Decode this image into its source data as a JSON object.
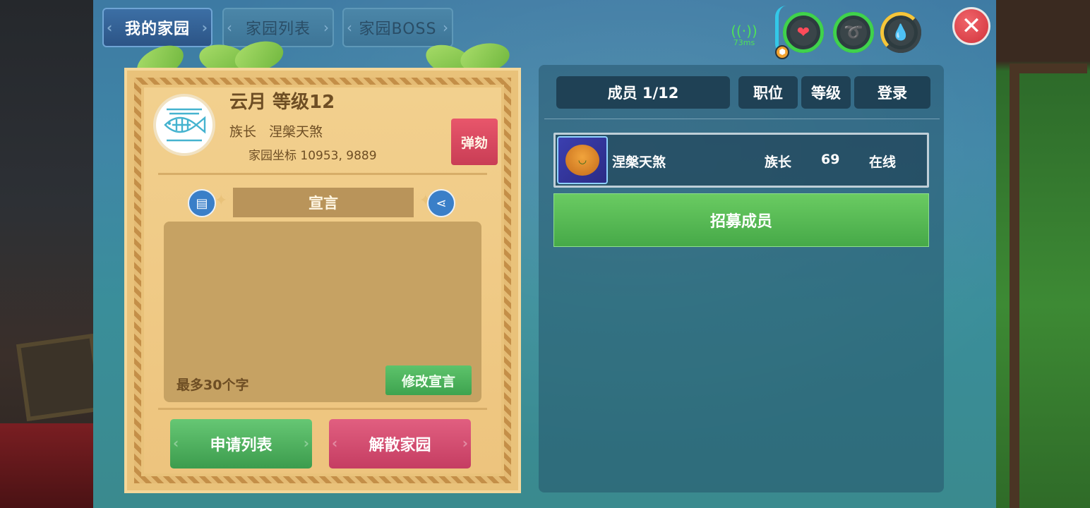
{
  "tabs": [
    {
      "label": "我的家园",
      "active": true
    },
    {
      "label": "家园列表",
      "active": false
    },
    {
      "label": "家园BOSS",
      "active": false
    }
  ],
  "status": {
    "ping": "73ms",
    "icons": [
      "heart-icon",
      "food-icon",
      "water-drop-icon"
    ]
  },
  "home": {
    "name_level": "云月 等级12",
    "leader_label": "族长",
    "leader_name": "涅槃天煞",
    "coords_label": "家园坐标",
    "coords_value": "10953, 9889",
    "impeach_label": "弹劾",
    "declaration_title": "宣言",
    "declaration_hint": "最多30个字",
    "edit_declaration_label": "修改宣言",
    "apply_list_label": "申请列表",
    "disband_label": "解散家园"
  },
  "members": {
    "headers": {
      "member": "成员 1/12",
      "role": "职位",
      "level": "等级",
      "login": "登录"
    },
    "rows": [
      {
        "name": "涅槃天煞",
        "role": "族长",
        "level": "69",
        "status": "在线"
      }
    ],
    "recruit_label": "招募成员"
  },
  "colors": {
    "tab_active": "#2c5486",
    "panel_bg": "#3f86a6",
    "card_bg": "#edc47e",
    "green_button": "#46a948",
    "red_button": "#c53d62",
    "close_button": "#d1333c"
  }
}
